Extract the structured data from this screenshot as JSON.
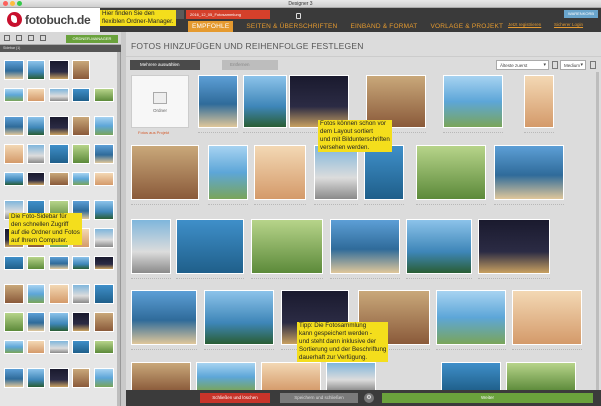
{
  "window": {
    "title": "Designer 3"
  },
  "header": {
    "logo_text": "fotobuch.de",
    "project_tab": "2016_12_05_Fotosammlung",
    "nav": [
      "EMPFOHLE",
      "SEITEN & ÜBERSCHRIFTEN",
      "EINBAND & FORMAT",
      "VORLAGE & PROJEKT"
    ],
    "register_link": "Jetzt registrieren",
    "login_link": "Sicherer Login",
    "cart_label": "WARENKORB"
  },
  "sidebar": {
    "folder_manager_button": "ORDNER-MANAGER",
    "section_label": "Sidebar (1)"
  },
  "main": {
    "title": "FOTOS HINZUFÜGEN UND REIHENFOLGE FESTLEGEN",
    "select_all_button": "Mehrere auswählen",
    "delete_button": "Entfernen",
    "sort_select": "Älteste zuerst",
    "size_select": "Medium",
    "upload_folder_label": "Ordner",
    "upload_caption": "Fotos aus Projekt"
  },
  "tooltips": {
    "top": "Hier finden Sie den\nflexiblen Ordner-Manager.",
    "center": "Fotos können schon vor\ndem Layout sortiert\nund mit Bildunterschriften\nversehen werden.",
    "left": "Die Foto-Sidebar für\nden schnellen Zugriff\nauf die Ordner und Fotos\nauf Ihrem Computer.",
    "bottom": "Tipp: Die Fotosammlung\nkann gespeichert werden -\nund steht dann inklusive der\nSortierung und der Beschriftung\ndauerhaft zur Verfügung."
  },
  "bottom_bar": {
    "close_button": "Schließen und löschen",
    "save_close_button": "Speichern und schließen",
    "next_button": "Weiter"
  },
  "colors": {
    "accent_orange": "#e59a2f",
    "red": "#d5402b",
    "green": "#6aa23c",
    "tooltip_yellow": "#f4de1c",
    "header_dark": "#3a3a3a"
  }
}
